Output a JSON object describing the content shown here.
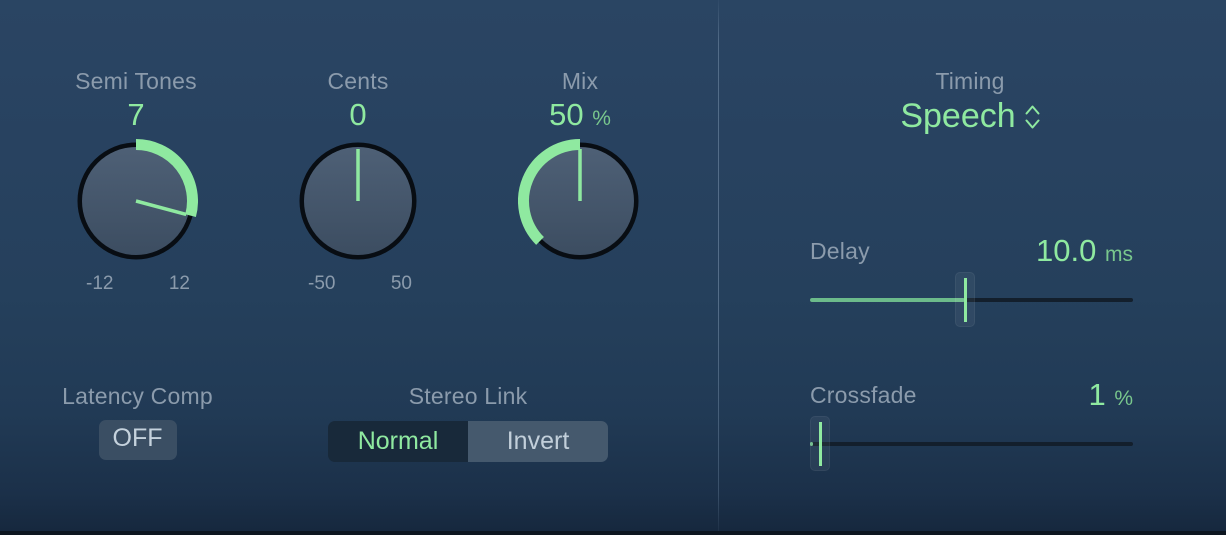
{
  "theme": {
    "background_top": "#2a4563",
    "background_bottom": "#16283e",
    "label_color": "#8b9bac",
    "accent_green": "#8fe9a0",
    "fill_green": "#6cbb8b",
    "segment_on_bg": "#18293a",
    "segment_off_bg": "#45596d"
  },
  "knobs": [
    {
      "name": "semi-tones",
      "label": "Semi Tones",
      "value": "7",
      "tick_min": "-12",
      "tick_max": "12",
      "arc_start_deg": 0,
      "arc_end_deg": 105,
      "pointer_deg": 105
    },
    {
      "name": "cents",
      "label": "Cents",
      "value": "0",
      "tick_min": "-50",
      "tick_max": "50",
      "arc_start_deg": 0,
      "arc_end_deg": 0,
      "pointer_deg": 0
    },
    {
      "name": "mix",
      "label": "Mix",
      "value": "50",
      "unit": "%",
      "tick_min": "",
      "tick_max": "",
      "arc_start_deg": -135,
      "arc_end_deg": 0,
      "pointer_deg": 0
    }
  ],
  "latency_comp": {
    "label": "Latency Comp",
    "button_label": "OFF"
  },
  "stereo_link": {
    "label": "Stereo Link",
    "options": [
      "Normal",
      "Invert"
    ],
    "selected": "Normal"
  },
  "timing": {
    "label": "Timing",
    "value": "Speech"
  },
  "sliders": [
    {
      "name": "delay",
      "label": "Delay",
      "value": "10.0",
      "unit": "ms",
      "percent": 48
    },
    {
      "name": "crossfade",
      "label": "Crossfade",
      "value": "1",
      "unit": "%",
      "percent": 1
    }
  ]
}
